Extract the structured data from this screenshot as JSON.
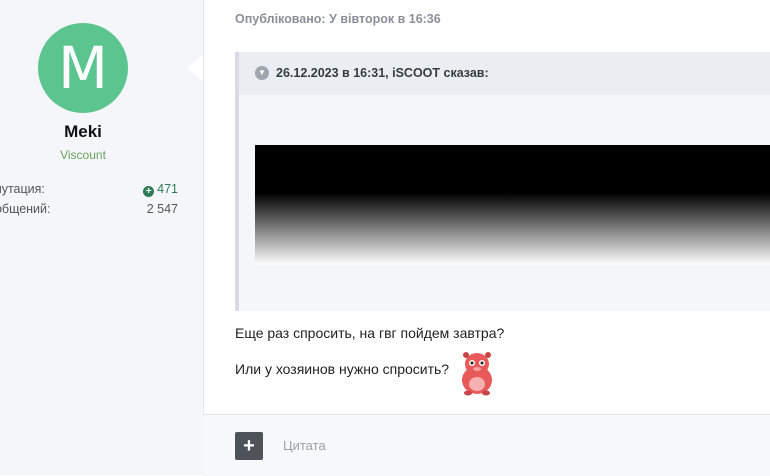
{
  "author": {
    "avatar_letter": "M",
    "avatar_color": "#5cc58f",
    "name": "Meki",
    "rank": "Viscount",
    "stats": [
      {
        "label": "епутация:",
        "value": "471"
      },
      {
        "label": "робщений:",
        "value": "2 547"
      }
    ]
  },
  "post": {
    "posted": "Опубліковано: У вівторок в 16:36",
    "quote": {
      "citation": "26.12.2023 в 16:31, iSCOOT сказав:"
    },
    "lines": [
      "Еще раз спросить, на гвг пойдем завтра?",
      "Или у хозяинов нужно спросить?"
    ]
  },
  "footer": {
    "quote_label": "Цитата"
  }
}
